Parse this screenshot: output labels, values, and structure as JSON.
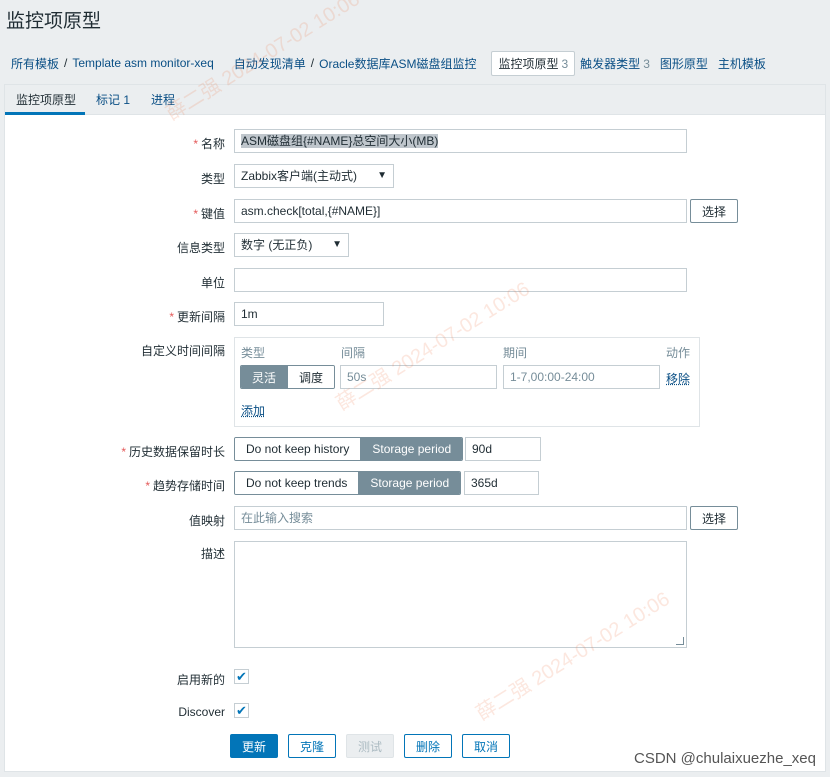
{
  "page": {
    "title": "监控项原型"
  },
  "breadcrumb": {
    "all_templates": "所有模板",
    "template": "Template asm monitor-xeq",
    "discovery": "自动发现清单",
    "rule": "Oracle数据库ASM磁盘组监控",
    "tabs": [
      {
        "label": "监控项原型",
        "count": "3"
      },
      {
        "label": "触发器类型",
        "count": "3"
      },
      {
        "label": "图形原型",
        "count": ""
      },
      {
        "label": "主机模板",
        "count": ""
      }
    ]
  },
  "form_tabs": [
    {
      "label": "监控项原型",
      "count": ""
    },
    {
      "label": "标记",
      "count": "1"
    },
    {
      "label": "进程",
      "count": ""
    }
  ],
  "form": {
    "name_label": "名称",
    "name_value": "ASM磁盘组{#NAME}总空间大小(MB)",
    "type_label": "类型",
    "type_value": "Zabbix客户端(主动式)",
    "key_label": "键值",
    "key_value": "asm.check[total,{#NAME}]",
    "select_button": "选择",
    "info_type_label": "信息类型",
    "info_type_value": "数字 (无正负)",
    "units_label": "单位",
    "units_value": "",
    "interval_label": "更新间隔",
    "interval_value": "1m",
    "custom_label": "自定义时间间隔",
    "custom": {
      "col_type": "类型",
      "col_interval": "间隔",
      "col_period": "期间",
      "col_action": "动作",
      "flexible": "灵活",
      "scheduling": "调度",
      "interval_placeholder": "50s",
      "period_placeholder": "1-7,00:00-24:00",
      "remove": "移除",
      "add": "添加"
    },
    "history_label": "历史数据保留时长",
    "history_off": "Do not keep history",
    "history_on": "Storage period",
    "history_value": "90d",
    "trends_label": "趋势存储时间",
    "trends_off": "Do not keep trends",
    "trends_on": "Storage period",
    "trends_value": "365d",
    "valuemap_label": "值映射",
    "valuemap_placeholder": "在此输入搜索",
    "description_label": "描述",
    "enable_label": "启用新的",
    "discover_label": "Discover"
  },
  "actions": {
    "update": "更新",
    "clone": "克隆",
    "test": "测试",
    "delete": "删除",
    "cancel": "取消"
  },
  "watermark": {
    "author": "薛二强",
    "datetime": "2024-07-02 10:06"
  },
  "credit": "CSDN @chulaixuezhe_xeq",
  "colors": {
    "accent": "#0275b8",
    "required": "#e45959",
    "segment_active": "#768d99"
  }
}
